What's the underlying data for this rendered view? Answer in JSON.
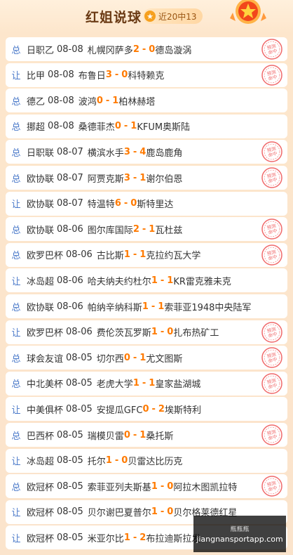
{
  "header": {
    "title": "红姐说球",
    "record": "近20中13"
  },
  "stamp_text": "预测命中",
  "rows": [
    {
      "type": "总",
      "league": "日职乙",
      "date": "08-08",
      "home": "札幌冈萨多",
      "score_home": "2",
      "score_away": "0",
      "away": "德岛漩涡",
      "hit": true
    },
    {
      "type": "让",
      "league": "比甲",
      "date": "08-08",
      "home": "布鲁日",
      "score_home": "3",
      "score_away": "0",
      "away": "科特赖克",
      "hit": true
    },
    {
      "type": "总",
      "league": "德乙",
      "date": "08-08",
      "home": "波鸿",
      "score_home": "0",
      "score_away": "1",
      "away": "柏林赫塔",
      "hit": false
    },
    {
      "type": "总",
      "league": "挪超",
      "date": "08-08",
      "home": "桑德菲杰",
      "score_home": "0",
      "score_away": "1",
      "away": "KFUM奥斯陆",
      "hit": false
    },
    {
      "type": "总",
      "league": "日职联",
      "date": "08-07",
      "home": "横滨水手",
      "score_home": "3",
      "score_away": "4",
      "away": "鹿岛鹿角",
      "hit": true
    },
    {
      "type": "总",
      "league": "欧协联",
      "date": "08-07",
      "home": "阿贾克斯",
      "score_home": "3",
      "score_away": "1",
      "away": "谢尔伯恩",
      "hit": true
    },
    {
      "type": "让",
      "league": "欧协联",
      "date": "08-07",
      "home": "特温特",
      "score_home": "6",
      "score_away": "0",
      "away": "斯特里达",
      "hit": false
    },
    {
      "type": "总",
      "league": "欧协联",
      "date": "08-06",
      "home": "图尔库国际",
      "score_home": "2",
      "score_away": "1",
      "away": "瓦杜兹",
      "hit": true
    },
    {
      "type": "总",
      "league": "欧罗巴杯",
      "date": "08-06",
      "home": "古比斯",
      "score_home": "1",
      "score_away": "1",
      "away": "克拉约瓦大学",
      "hit": true
    },
    {
      "type": "让",
      "league": "冰岛超",
      "date": "08-06",
      "home": "哈夫纳夫约杜尔",
      "score_home": "1",
      "score_away": "1",
      "away": "KR雷克雅未克",
      "hit": false
    },
    {
      "type": "总",
      "league": "欧协联",
      "date": "08-06",
      "home": "帕纳辛纳科斯",
      "score_home": "1",
      "score_away": "1",
      "away": "索菲亚1948中央陆军",
      "hit": false
    },
    {
      "type": "让",
      "league": "欧罗巴杯",
      "date": "08-06",
      "home": "费伦茨瓦罗斯",
      "score_home": "1",
      "score_away": "0",
      "away": "扎布热矿工",
      "hit": true
    },
    {
      "type": "总",
      "league": "球会友谊",
      "date": "08-05",
      "home": "切尔西",
      "score_home": "0",
      "score_away": "1",
      "away": "尤文图斯",
      "hit": true
    },
    {
      "type": "总",
      "league": "中北美杯",
      "date": "08-05",
      "home": "老虎大学",
      "score_home": "1",
      "score_away": "1",
      "away": "皇家盐湖城",
      "hit": true
    },
    {
      "type": "让",
      "league": "中美俱杯",
      "date": "08-05",
      "home": "安提瓜GFC",
      "score_home": "0",
      "score_away": "2",
      "away": "埃斯特利",
      "hit": false
    },
    {
      "type": "总",
      "league": "巴西杯",
      "date": "08-05",
      "home": "瑞模贝雷",
      "score_home": "0",
      "score_away": "1",
      "away": "桑托斯",
      "hit": true
    },
    {
      "type": "让",
      "league": "冰岛超",
      "date": "08-05",
      "home": "托尔",
      "score_home": "1",
      "score_away": "0",
      "away": "贝雷达比历克",
      "hit": false
    },
    {
      "type": "总",
      "league": "欧冠杯",
      "date": "08-05",
      "home": "索菲亚列夫斯基",
      "score_home": "1",
      "score_away": "0",
      "away": "阿拉木图凯拉特",
      "hit": true
    },
    {
      "type": "让",
      "league": "欧冠杯",
      "date": "08-05",
      "home": "贝尔谢巴夏普尔",
      "score_home": "1",
      "score_away": "0",
      "away": "贝尔格莱德红星",
      "hit": false
    },
    {
      "type": "让",
      "league": "欧冠杯",
      "date": "08-05",
      "home": "米亚尔比",
      "score_home": "1",
      "score_away": "2",
      "away": "布拉迪斯拉发",
      "hit": false
    }
  ],
  "watermark": {
    "line1": "瓶瓶瓶",
    "line2": "jiangnansportapp.com"
  }
}
